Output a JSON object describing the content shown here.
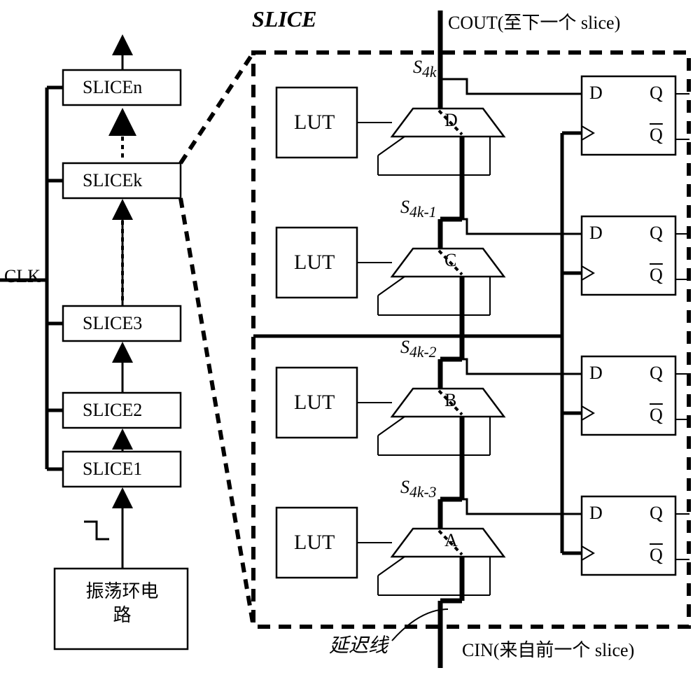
{
  "title": "SLICE",
  "clk": "CLK",
  "osc": "振荡环电\n路",
  "delay_line_label": "延迟线",
  "cout": "COUT(至下一个 slice)",
  "cin": "CIN(来自前一个 slice)",
  "left_slices": {
    "n": "SLICEn",
    "k": "SLICEk",
    "s3": "SLICE3",
    "s2": "SLICE2",
    "s1": "SLICE1"
  },
  "lut": "LUT",
  "ff": {
    "D": "D",
    "Q": "Q",
    "Qbar": "Q"
  },
  "mux_id": {
    "A": "A",
    "B": "B",
    "C": "C",
    "D": "D"
  },
  "tap": {
    "s4k": "S4k",
    "s4k1": "S4k-1",
    "s4k2": "S4k-2",
    "s4k3": "S4k-3"
  }
}
